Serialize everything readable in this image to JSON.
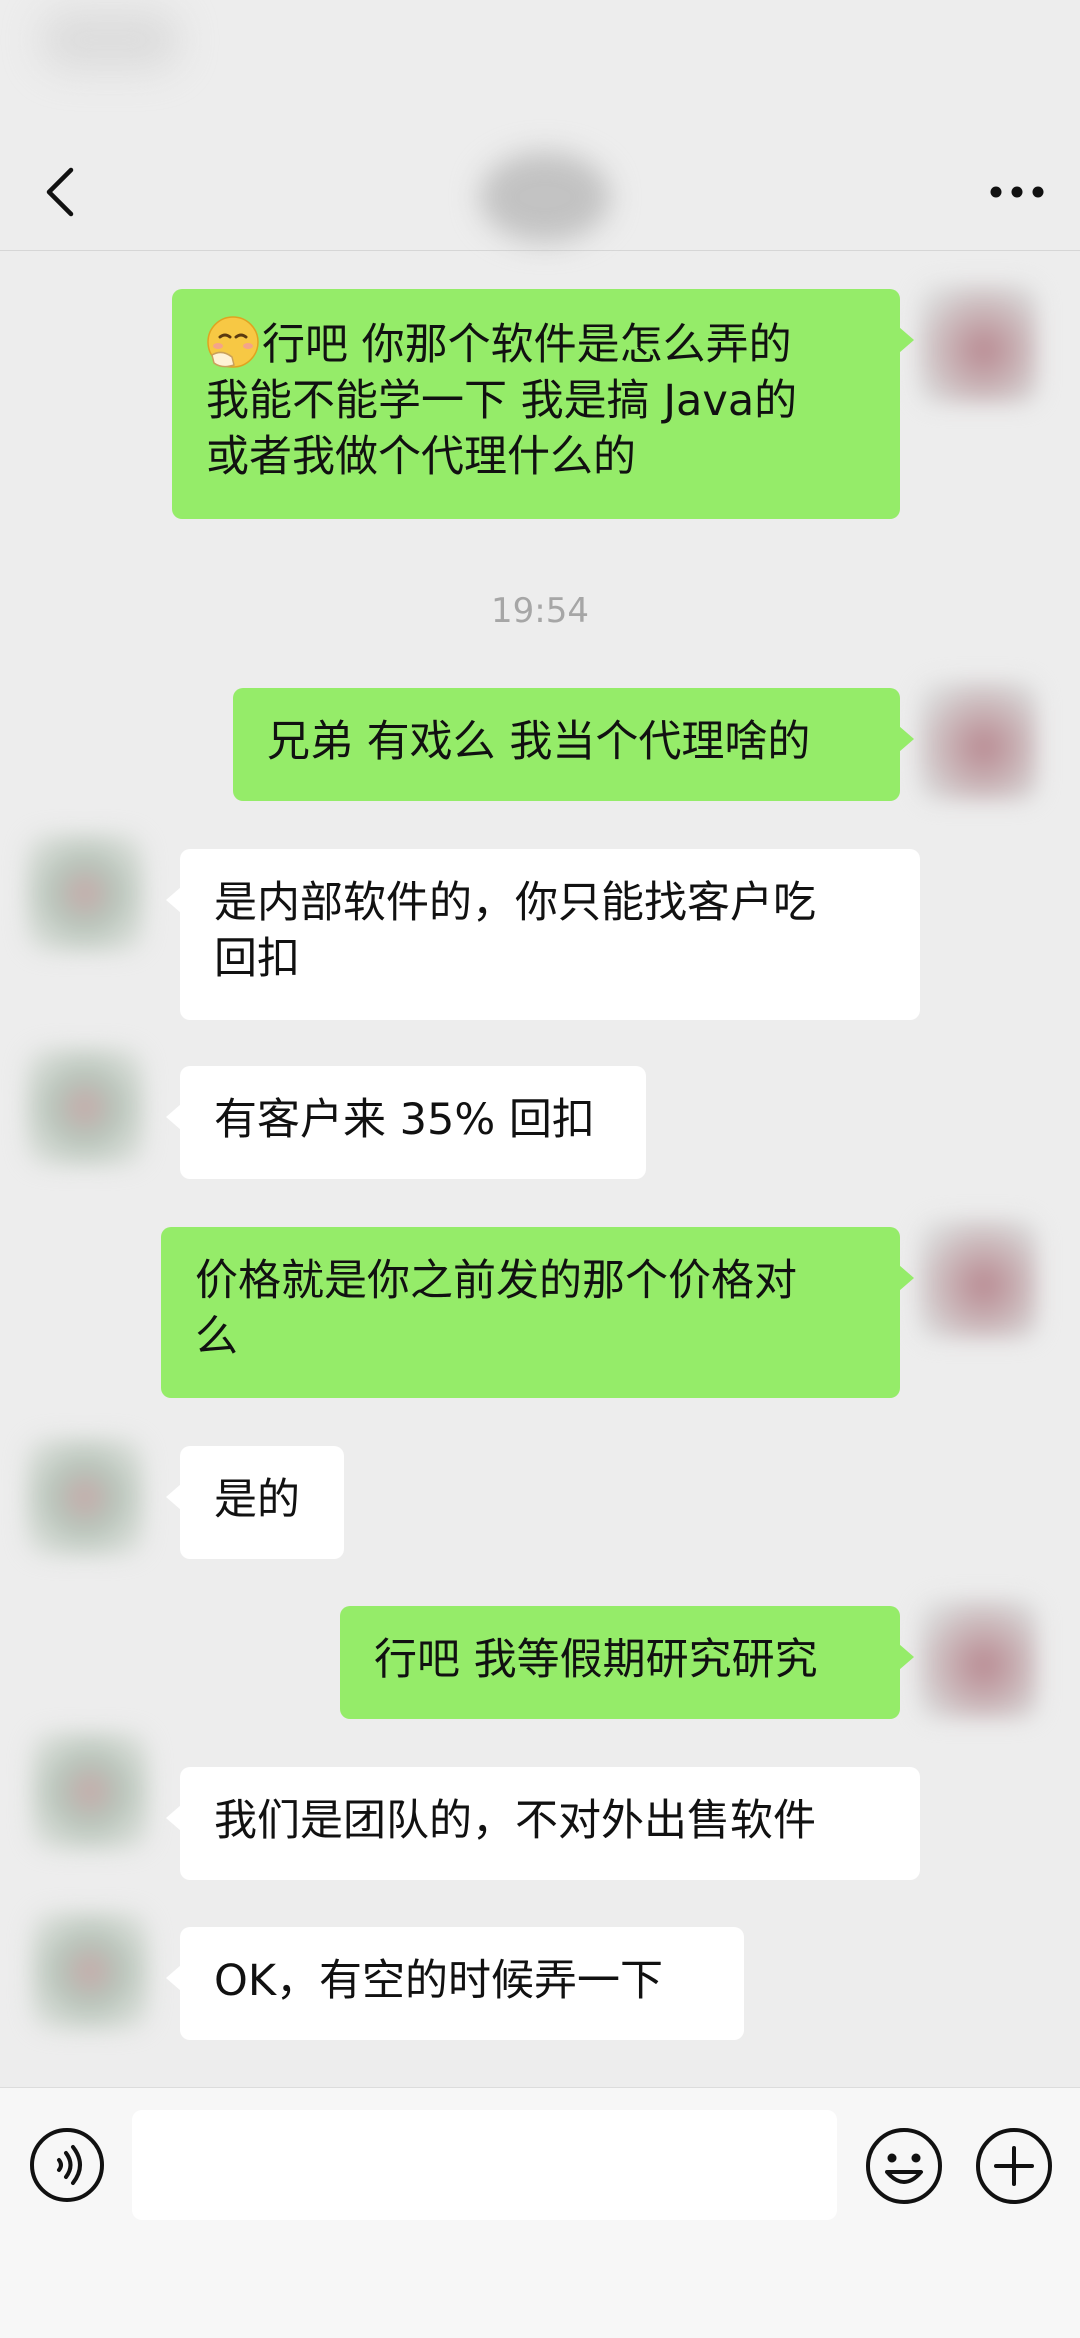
{
  "header": {
    "back_icon": "chevron-left-icon",
    "more_icon": "ellipsis-icon"
  },
  "messages": [
    {
      "side": "me",
      "emoji": "face-with-hand-over-mouth",
      "lines": [
        "行吧 你那个软件是怎么弄的",
        "我能不能学一下 我是搞 Java的",
        "或者我做个代理什么的"
      ]
    },
    {
      "type": "time",
      "text": "19:54"
    },
    {
      "side": "me",
      "lines": [
        "兄弟 有戏么 我当个代理啥的"
      ]
    },
    {
      "side": "other",
      "lines": [
        "是内部软件的，你只能找客户吃",
        "回扣"
      ]
    },
    {
      "side": "other",
      "lines": [
        "有客户来 35% 回扣"
      ]
    },
    {
      "side": "me",
      "lines": [
        "价格就是你之前发的那个价格对",
        "么"
      ]
    },
    {
      "side": "other",
      "lines": [
        "是的"
      ]
    },
    {
      "side": "me",
      "lines": [
        "行吧 我等假期研究研究"
      ]
    },
    {
      "side": "other",
      "lines": [
        "我们是团队的，不对外出售软件"
      ]
    },
    {
      "side": "other",
      "lines": [
        "OK，有空的时候弄一下"
      ]
    }
  ],
  "input_bar": {
    "voice_icon": "voice-icon",
    "input_value": "",
    "emoji_icon": "emoji-icon",
    "plus_icon": "plus-icon"
  },
  "colors": {
    "background": "#ededed",
    "my_bubble": "#95ec69",
    "other_bubble": "#ffffff",
    "timestamp": "#a6a6a6"
  }
}
